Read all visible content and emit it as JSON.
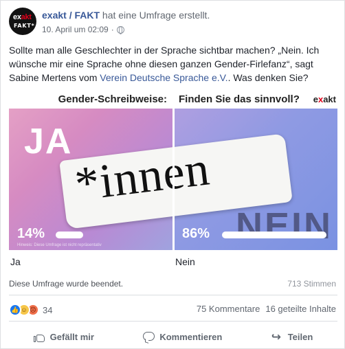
{
  "post": {
    "author": "exakt / FAKT",
    "action": "hat eine Umfrage erstellt.",
    "timestamp": "10. April um 02:09",
    "avatar": {
      "line1_a": "ex",
      "line1_b": "akt",
      "line2": "FAKT*"
    },
    "text_before_link": "Sollte man alle Geschlechter in der Sprache sichtbar machen? „Nein. Ich wünsche mir eine Sprache ohne diesen ganzen Gender-Firlefanz“, sagt Sabine Mertens vom ",
    "link_text": "Verein Deutsche Sprache e.V.",
    "text_after_link": ". Was denken Sie?"
  },
  "poll": {
    "banner_left": "Gender-Schreibweise:",
    "banner_right": "Finden Sie das sinnvoll?",
    "brand_a": "e",
    "brand_b": "x",
    "brand_c": "akt",
    "big_left": "JA",
    "big_right": "NEIN",
    "center_word": "*innen",
    "disclaimer": "Hinweis: Diese Umfrage ist nicht repräsentativ",
    "options": [
      {
        "label": "Ja",
        "percent_text": "14%",
        "percent": 14
      },
      {
        "label": "Nein",
        "percent_text": "86%",
        "percent": 86
      }
    ],
    "ended_text": "Diese Umfrage wurde beendet.",
    "votes_text": "713 Stimmen"
  },
  "footer": {
    "reaction_count": "34",
    "comments": "75 Kommentare",
    "shares": "16 geteilte Inhalte",
    "like_label": "Gefällt mir",
    "comment_label": "Kommentieren",
    "share_label": "Teilen"
  },
  "colors": {
    "link": "#385898",
    "brand_red": "#e2001a",
    "like_blue": "#1877f2"
  }
}
